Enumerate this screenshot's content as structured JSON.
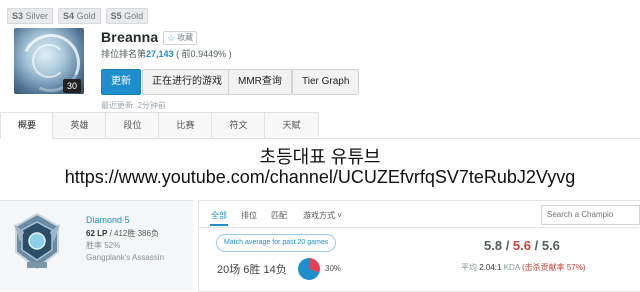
{
  "season_badges": [
    {
      "season": "S3",
      "tier": "Silver"
    },
    {
      "season": "S4",
      "tier": "Gold"
    },
    {
      "season": "S5",
      "tier": "Gold"
    }
  ],
  "profile": {
    "level": "30",
    "name": "Breanna",
    "favorite_label": "收藏",
    "ranking_label": "排位排名第",
    "ranking_number": "27,143",
    "ranking_percent": "( 前0.9449% )",
    "last_updated": "最近更新: 2分钟前"
  },
  "buttons": {
    "refresh": "更新",
    "live_game": "正在进行的游戏",
    "mmr": "MMR查询",
    "tier_graph": "Tier Graph"
  },
  "tabs": [
    "概要",
    "英雄",
    "段位",
    "比赛",
    "符文",
    "天赋"
  ],
  "overlay": {
    "title": "초등대표 유튜브",
    "url": "https://www.youtube.com/channel/UCUZEfvrfqSV7teRubJ2Vyvg"
  },
  "rank": {
    "tier": "Diamond 5",
    "lp": "62 LP",
    "wins_losses": "/ 412胜 386负",
    "win_rate": "胜率 52%",
    "league": "Gangplank's Assassin"
  },
  "game_filters": {
    "tabs": [
      "全部",
      "排位",
      "匹配",
      "游戏方式 ˅"
    ],
    "search_placeholder": "Search a Champio"
  },
  "summary": {
    "match_average": "Match average for past 20 games",
    "record": "20场 6胜 14负",
    "win_rate": 30,
    "win_rate_text": "30%",
    "kda_kills": "5.8",
    "kda_deaths": "5.6",
    "kda_assists": "5.6",
    "kda_prefix": "平均",
    "kda_value": "2.04:1",
    "kda_label": "KDA",
    "kill_participation": "(击杀贡献率 57%)"
  },
  "colors": {
    "accent": "#1f8ecd",
    "loss": "#e84057",
    "deaths": "#c6443e"
  }
}
